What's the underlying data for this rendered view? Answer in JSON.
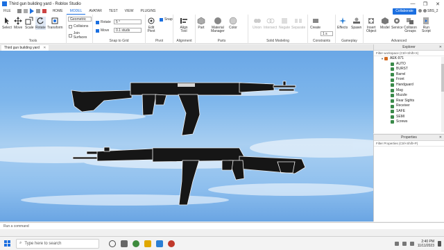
{
  "window": {
    "title": "Third gun building yard - Roblox Studio",
    "controls": [
      "—",
      "❐",
      "✕"
    ]
  },
  "menubar": {
    "items": [
      "FILE",
      "HOME",
      "MODEL",
      "AVATAR",
      "TEST",
      "VIEW",
      "PLUGINS"
    ],
    "active": "MODEL",
    "collaborate_label": "Collaborate",
    "username": "SBS_2"
  },
  "ribbon": {
    "tools": {
      "select": "Select",
      "move": "Move",
      "scale": "Scale",
      "rotate": "Rotate",
      "transform": "Transform",
      "group_label": "Tools"
    },
    "geometric": "Geometric",
    "collisions": "Collisions",
    "join_surfaces": "Join Surfaces",
    "snap_rotate": "Rotate",
    "snap_rotate_value": "5 °",
    "snap_move": "Move",
    "snap_move_value": "0.1 studs",
    "snap_group": "Snap to Grid",
    "edit_pivot": "Edit\nPivot",
    "snap": "Snap",
    "pivot_group": "Pivot",
    "align_tool": "Align\nTool",
    "alignment_group": "Alignment",
    "part": "Part",
    "material_manager": "Material\nManager",
    "color": "Color",
    "parts_group": "Parts",
    "union": "Union",
    "intersect": "Intersect",
    "negate": "Negate",
    "separate": "Separate",
    "solid_group": "Solid Modeling",
    "create": "Create",
    "constraint_value": "1 s",
    "constraints_group": "Constraints",
    "effects": "Effects",
    "spawn": "Spawn",
    "gameplay_group": "Gameplay",
    "insert_object": "Insert\nObject",
    "model": "Model",
    "service": "Service",
    "collision_groups": "Collision\nGroups",
    "run_script": "Run\nScript",
    "advanced_group": "Advanced"
  },
  "doc_tab": {
    "label": "Third gun building yard",
    "close": "✕"
  },
  "explorer": {
    "title": "Explorer",
    "filter_placeholder": "Filter workspace (Ctrl+Shift+X)",
    "root": "AEK-971",
    "items": [
      "AUTO",
      "BURST",
      "Barrel",
      "Front",
      "Handguard",
      "Mag",
      "Muzzle",
      "Rear Sights",
      "Receiver",
      "SAFE",
      "SEMI",
      "Screws"
    ]
  },
  "properties": {
    "title": "Properties",
    "filter_placeholder": "Filter Properties (Ctrl+Shift+P)"
  },
  "command_bar": {
    "placeholder": "Run a command"
  },
  "taskbar": {
    "search_placeholder": "Type here to search",
    "time": "2:40 PM",
    "date": "11/11/2023"
  }
}
